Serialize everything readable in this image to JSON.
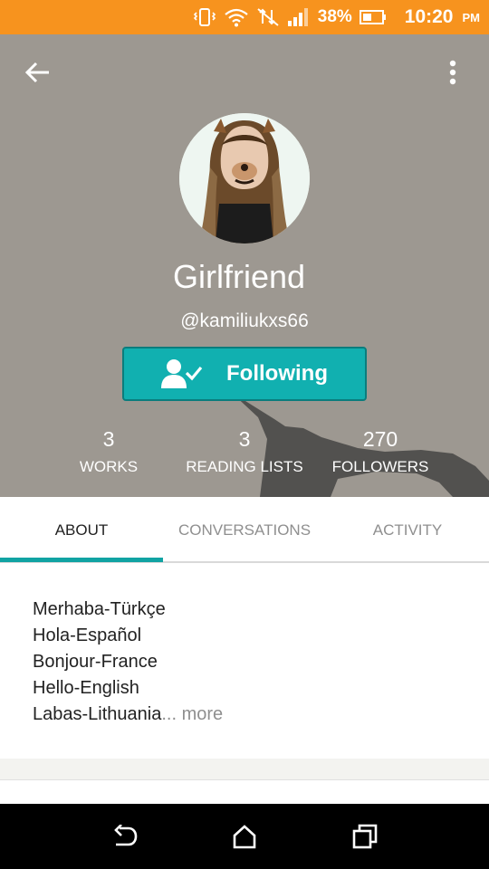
{
  "status_bar": {
    "battery_percent": "38%",
    "time": "10:20",
    "ampm": "PM",
    "icons": [
      "vibrate-icon",
      "wifi-icon",
      "data-off-icon",
      "signal-icon",
      "battery-icon"
    ]
  },
  "header": {
    "background_color": "#9d9891",
    "back_icon": "arrow-left-icon",
    "more_icon": "more-vertical-icon"
  },
  "profile": {
    "display_name": "Girlfriend",
    "username": "@kamiliukxs66",
    "follow_button_label": "Following",
    "follow_button_color": "#11b0b0"
  },
  "stats": [
    {
      "value": "3",
      "label": "WORKS"
    },
    {
      "value": "3",
      "label": "READING LISTS"
    },
    {
      "value": "270",
      "label": "FOLLOWERS"
    }
  ],
  "tabs": [
    {
      "label": "ABOUT",
      "active": true
    },
    {
      "label": "CONVERSATIONS",
      "active": false
    },
    {
      "label": "ACTIVITY",
      "active": false
    }
  ],
  "accent_color": "#11a3a3",
  "about": {
    "lines": [
      "Merhaba-Türkçe",
      "Hola-Español",
      "Bonjour-France",
      "Hello-English",
      "Labas-Lithuania"
    ],
    "ellipsis": "...",
    "more_label": " more"
  },
  "nav_bar": {
    "icons": [
      "back-icon",
      "home-icon",
      "recent-apps-icon"
    ]
  }
}
